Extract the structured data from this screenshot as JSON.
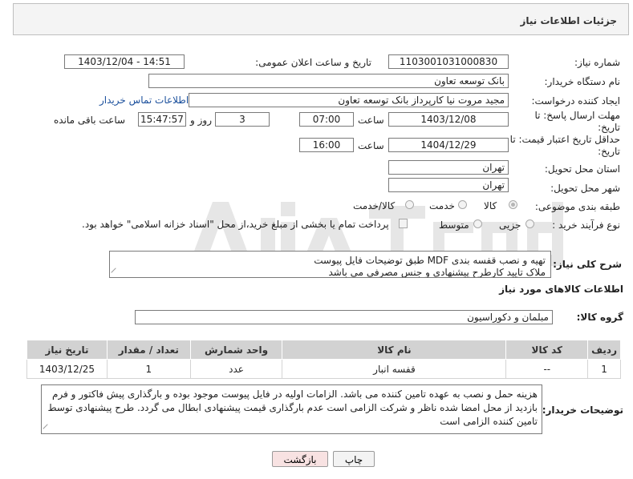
{
  "header": {
    "title": "جزئیات اطلاعات نیاز"
  },
  "form": {
    "need_number": {
      "label": "شماره نیاز:",
      "value": "1103001031000830"
    },
    "announce": {
      "label": "تاریخ و ساعت اعلان عمومی:",
      "value": "1403/12/04 - 14:51"
    },
    "buyer_org": {
      "label": "نام دستگاه خریدار:",
      "value": "بانک توسعه تعاون"
    },
    "creator": {
      "label": "ایجاد کننده درخواست:",
      "value": "مجید مروت نیا کارپرداز بانک توسعه تعاون",
      "contact_link": "اطلاعات تماس خریدار"
    },
    "reply_deadline": {
      "label_line1": "مهلت ارسال پاسخ: تا",
      "label_line2": "تاریخ:",
      "date": "1403/12/08",
      "time_label": "ساعت",
      "time": "07:00",
      "days": "3",
      "days_label": "روز و",
      "remaining": "15:47:57",
      "remaining_label": "ساعت باقی مانده"
    },
    "price_validity": {
      "label_line1": "حداقل تاریخ اعتبار قیمت: تا",
      "label_line2": "تاریخ:",
      "date": "1404/12/29",
      "time_label": "ساعت",
      "time": "16:00"
    },
    "province": {
      "label": "استان محل تحویل:",
      "value": "تهران"
    },
    "city": {
      "label": "شهر محل تحویل:",
      "value": "تهران"
    },
    "category": {
      "label": "طبقه بندی موضوعی:",
      "options": [
        "کالا",
        "خدمت",
        "کالا/خدمت"
      ],
      "selected": "کالا"
    },
    "purchase_type": {
      "label": "نوع فرآیند خرید :",
      "options": [
        "جزیی",
        "متوسط"
      ],
      "note": "پرداخت تمام یا بخشی از مبلغ خرید،از محل \"اسناد خزانه اسلامی\" خواهد بود."
    }
  },
  "description": {
    "label": "شرح کلی نیاز:",
    "text_line1": "تهیه و نصب قفسه بندی MDF طبق توضیحات فایل پیوست",
    "text_line2": "ملاک تایید کارطرح پیشنهادی و جنس مصرفی می باشد"
  },
  "goods_info": {
    "title": "اطلاعات کالاهای مورد نیاز"
  },
  "goods_group": {
    "label": "گروه کالا:",
    "value": "مبلمان و دکوراسیون"
  },
  "table": {
    "headers": [
      "ردیف",
      "کد کالا",
      "نام کالا",
      "واحد شمارش",
      "تعداد / مقدار",
      "تاریخ نیاز"
    ],
    "rows": [
      [
        "1",
        "--",
        "قفسه انبار",
        "عدد",
        "1",
        "1403/12/25"
      ]
    ]
  },
  "buyer_notes": {
    "label": "توضیحات خریدار:",
    "text": "هزینه حمل و نصب به عهده تامین کننده می باشد. الزامات اولیه در فایل پیوست موجود بوده و بارگذاری پیش فاکتور و فرم بازدید از محل امضا شده ناظر و شرکت الزامی است عدم بارگذاری قیمت پیشنهادی ابطال می گردد. طرح پیشنهادی توسط تامین کننده الزامی است"
  },
  "buttons": {
    "print": "چاپ",
    "back": "بازگشت"
  },
  "watermark_text": "AriaTender.neT"
}
